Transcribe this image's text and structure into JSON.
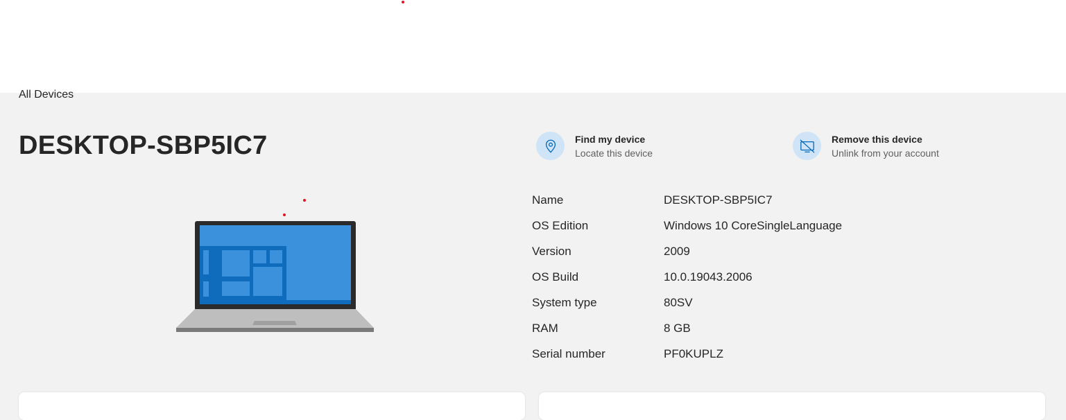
{
  "breadcrumb": "All Devices",
  "device": {
    "title": "DESKTOP-SBP5IC7"
  },
  "actions": [
    {
      "title": "Find my device",
      "subtitle": "Locate this device",
      "icon": "location-pin-icon"
    },
    {
      "title": "Remove this device",
      "subtitle": "Unlink from your account",
      "icon": "unlink-device-icon"
    }
  ],
  "specs": [
    {
      "label": "Name",
      "value": "DESKTOP-SBP5IC7"
    },
    {
      "label": "OS Edition",
      "value": "Windows 10 CoreSingleLanguage"
    },
    {
      "label": "Version",
      "value": "2009"
    },
    {
      "label": "OS Build",
      "value": "10.0.19043.2006"
    },
    {
      "label": "System type",
      "value": "80SV"
    },
    {
      "label": "RAM",
      "value": "8 GB"
    },
    {
      "label": "Serial number",
      "value": "PF0KUPLZ"
    }
  ],
  "colors": {
    "accent": "#0078d4",
    "icon_bg": "#cfe4f6",
    "page_bg": "#f2f2f2",
    "marker": "#e81123"
  }
}
